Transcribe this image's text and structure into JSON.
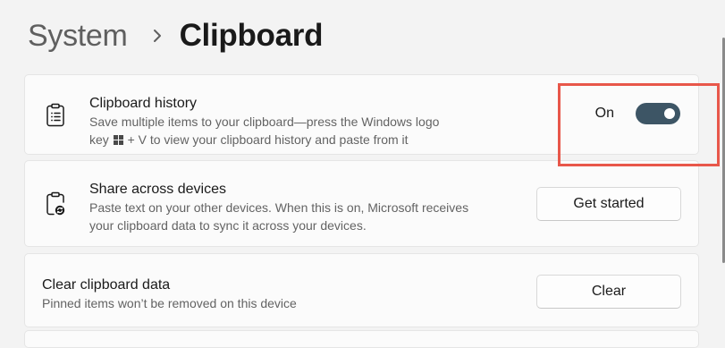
{
  "breadcrumb": {
    "parent": "System",
    "separator_icon": "chevron-right-icon",
    "current": "Clipboard"
  },
  "clipboard_history": {
    "icon": "clipboard-list-icon",
    "title": "Clipboard history",
    "desc_line1": "Save multiple items to your clipboard—press the Windows logo",
    "desc_line2_before": "key",
    "desc_line2_key_icon": "windows-logo-icon",
    "desc_line2_after": "+ V to view your clipboard history and paste from it",
    "toggle_state_label": "On",
    "toggle_on": true,
    "highlight_color": "#e8574a"
  },
  "share_across_devices": {
    "icon": "clipboard-sync-icon",
    "title": "Share across devices",
    "desc_line1": "Paste text on your other devices. When this is on, Microsoft receives",
    "desc_line2": "your clipboard data to sync it across your devices.",
    "button_label": "Get started"
  },
  "clear_clipboard": {
    "title": "Clear clipboard data",
    "desc": "Pinned items won’t be removed on this device",
    "button_label": "Clear"
  },
  "colors": {
    "toggle_accent": "#3d5565",
    "background": "#f3f3f3",
    "card": "#fbfbfb"
  }
}
